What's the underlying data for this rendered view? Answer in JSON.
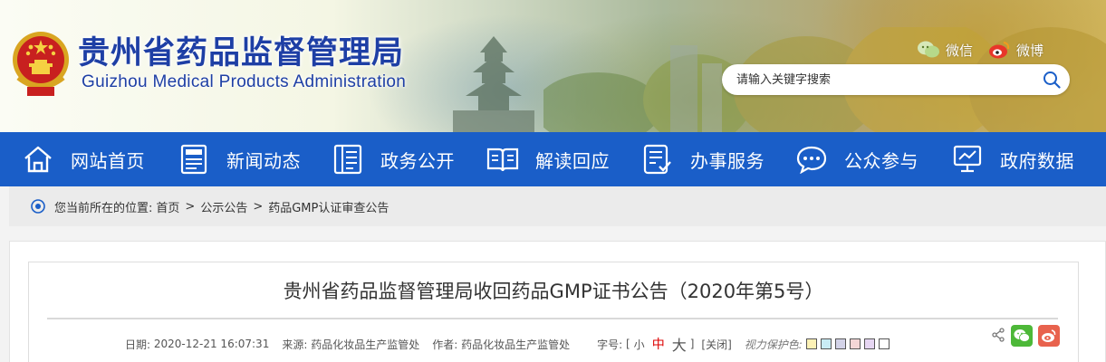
{
  "header": {
    "title": "贵州省药品监督管理局",
    "subtitle": "Guizhou Medical Products Administration",
    "wechat_label": "微信",
    "weibo_label": "微博",
    "search_placeholder": "请输入关键字搜索"
  },
  "nav": {
    "items": [
      {
        "label": "网站首页",
        "icon": "home-icon"
      },
      {
        "label": "新闻动态",
        "icon": "news-icon"
      },
      {
        "label": "政务公开",
        "icon": "document-icon"
      },
      {
        "label": "解读回应",
        "icon": "book-icon"
      },
      {
        "label": "办事服务",
        "icon": "service-icon"
      },
      {
        "label": "公众参与",
        "icon": "chat-icon"
      },
      {
        "label": "政府数据",
        "icon": "data-screen-icon"
      }
    ]
  },
  "breadcrumb": {
    "prefix": "您当前所在的位置:",
    "items": [
      "首页",
      "公示公告",
      "药品GMP认证审查公告"
    ],
    "separator": ">"
  },
  "article": {
    "title": "贵州省药品监督管理局收回药品GMP证书公告（2020年第5号）",
    "date_label": "日期:",
    "date": "2020-12-21 16:07:31",
    "source_label": "来源:",
    "source": "药品化妆品生产监管处",
    "author_label": "作者:",
    "author": "药品化妆品生产监管处",
    "font_size_label": "字号:",
    "bracket_open": "[",
    "bracket_close": "]",
    "font_small": "小",
    "font_medium": "中",
    "font_large": "大",
    "close_label": "[关闭]",
    "eye_protection_label": "视力保护色:",
    "swatch_colors": [
      "#fdf2b6",
      "#c9ecf5",
      "#d3d3e8",
      "#f3d6d6",
      "#e6d6f2",
      "#ffffff"
    ]
  },
  "colors": {
    "nav_bg": "#1a5ec8",
    "title_blue": "#1e3fa5",
    "wechat_green": "#4db838",
    "weibo_red": "#e8624d"
  }
}
